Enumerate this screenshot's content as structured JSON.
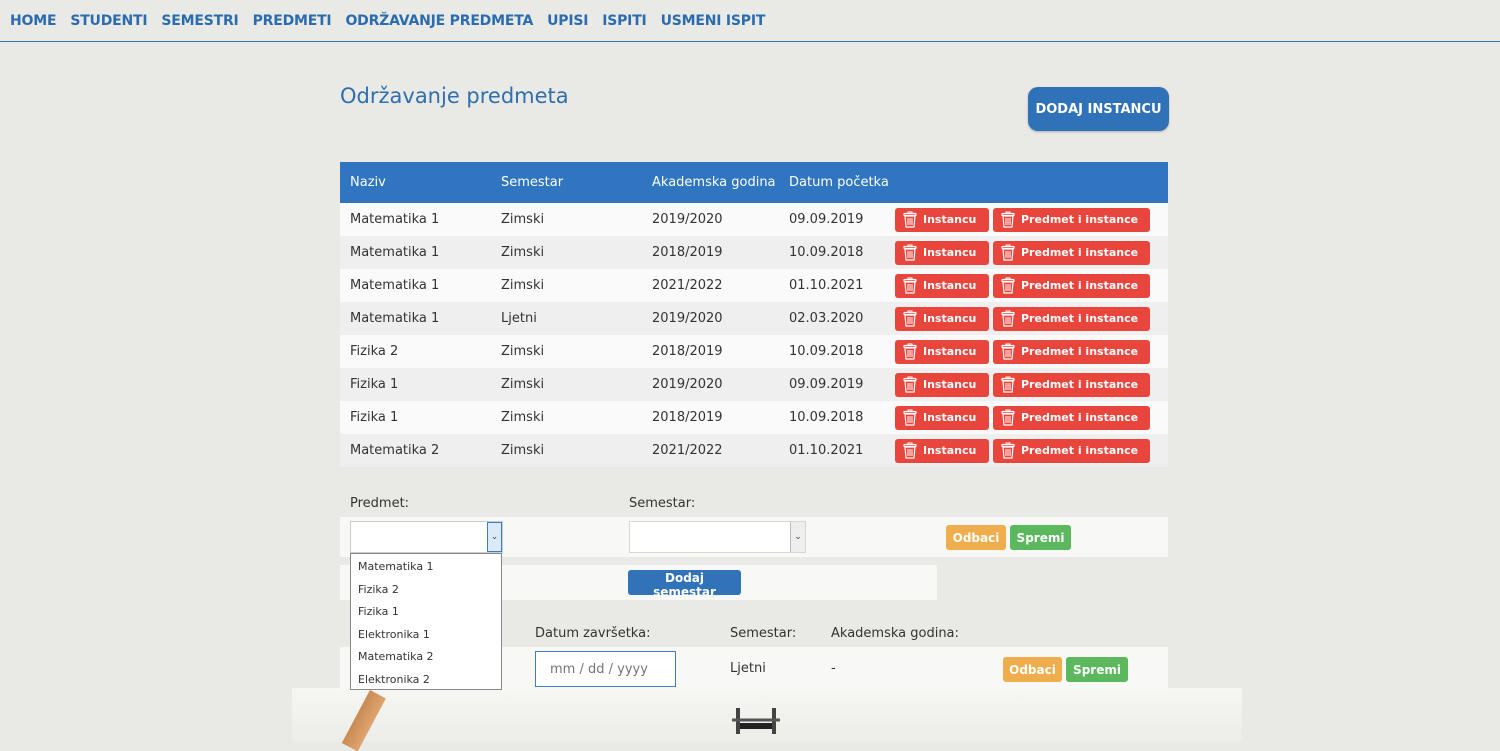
{
  "nav": {
    "items": [
      "HOME",
      "STUDENTI",
      "SEMESTRI",
      "PREDMETI",
      "ODRŽAVANJE PREDMETA",
      "UPISI",
      "ISPITI",
      "USMENI ISPIT"
    ]
  },
  "header": {
    "title": "Održavanje predmeta",
    "add_button": "DODAJ INSTANCU"
  },
  "table": {
    "columns": [
      "Naziv",
      "Semestar",
      "Akademska godina",
      "Datum početka"
    ],
    "delete_instance_label": "Instancu",
    "delete_subject_label": "Predmet i instance",
    "rows": [
      [
        "Matematika 1",
        "Zimski",
        "2019/2020",
        "09.09.2019"
      ],
      [
        "Matematika 1",
        "Zimski",
        "2018/2019",
        "10.09.2018"
      ],
      [
        "Matematika 1",
        "Zimski",
        "2021/2022",
        "01.10.2021"
      ],
      [
        "Matematika 1",
        "Ljetni",
        "2019/2020",
        "02.03.2020"
      ],
      [
        "Fizika 2",
        "Zimski",
        "2018/2019",
        "10.09.2018"
      ],
      [
        "Fizika 1",
        "Zimski",
        "2019/2020",
        "09.09.2019"
      ],
      [
        "Fizika 1",
        "Zimski",
        "2018/2019",
        "10.09.2018"
      ],
      [
        "Matematika 2",
        "Zimski",
        "2021/2022",
        "01.10.2021"
      ]
    ]
  },
  "add_form": {
    "subject_label": "Predmet:",
    "semester_label": "Semestar:",
    "cancel_label": "Odbaci",
    "save_label": "Spremi",
    "add_semester_label": "Dodaj semestar",
    "subject_options": [
      "Matematika 1",
      "Fizika 2",
      "Fizika 1",
      "Elektronika 1",
      "Matematika 2",
      "Elektronika 2"
    ]
  },
  "edit_form": {
    "end_date_label": "Datum završetka:",
    "semester_label": "Semestar:",
    "academic_year_label": "Akademska godina:",
    "end_date_placeholder": "mm / dd / yyyy",
    "semester_value": "Ljetni",
    "academic_year_value": "-",
    "cancel_label": "Odbaci",
    "save_label": "Spremi"
  },
  "colors": {
    "primary": "#2f75c0",
    "danger": "#e8453c",
    "warning": "#f0ad4e",
    "success": "#5cb85c",
    "background": "#e9e9e5"
  }
}
